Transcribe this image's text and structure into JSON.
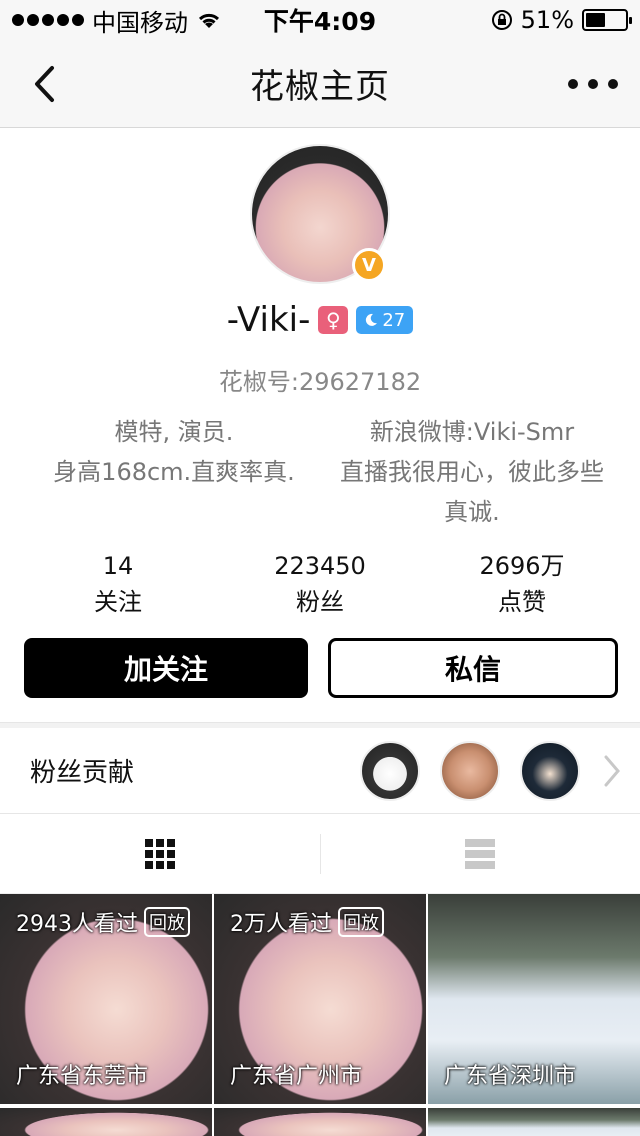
{
  "status_bar": {
    "carrier": "中国移动",
    "time": "下午4:09",
    "battery": "51%",
    "battery_level": 0.51
  },
  "nav": {
    "title": "花椒主页",
    "back_icon": "chevron-left-icon",
    "more_icon": "more-dots-icon"
  },
  "profile": {
    "name": "-Viki-",
    "verified_badge": "V",
    "gender_symbol": "♀",
    "level": "27",
    "uid": "花椒号:29627182",
    "bio": {
      "line1_left": "模特, 演员.",
      "line1_right": "新浪微博:Viki-Smr",
      "line2_left": "身高168cm.直爽率真.",
      "line2_right": "直播我很用心，彼此多些",
      "line3": "真诚."
    },
    "stats": [
      {
        "value": "14",
        "label": "关注"
      },
      {
        "value": "223450",
        "label": "粉丝"
      },
      {
        "value": "2696万",
        "label": "点赞"
      }
    ],
    "follow_label": "加关注",
    "message_label": "私信"
  },
  "fans": {
    "label": "粉丝贡献"
  },
  "videos": [
    {
      "views": "2943人看过",
      "badge": "回放",
      "location": "广东省东莞市"
    },
    {
      "views": "2万人看过",
      "badge": "回放",
      "location": "广东省广州市"
    },
    {
      "views": "",
      "badge": "",
      "location": "广东省深圳市"
    }
  ],
  "colors": {
    "follow_bg": "#000000",
    "gender": "#e9607a",
    "level": "#3da3f5",
    "verified": "#f5a623"
  }
}
